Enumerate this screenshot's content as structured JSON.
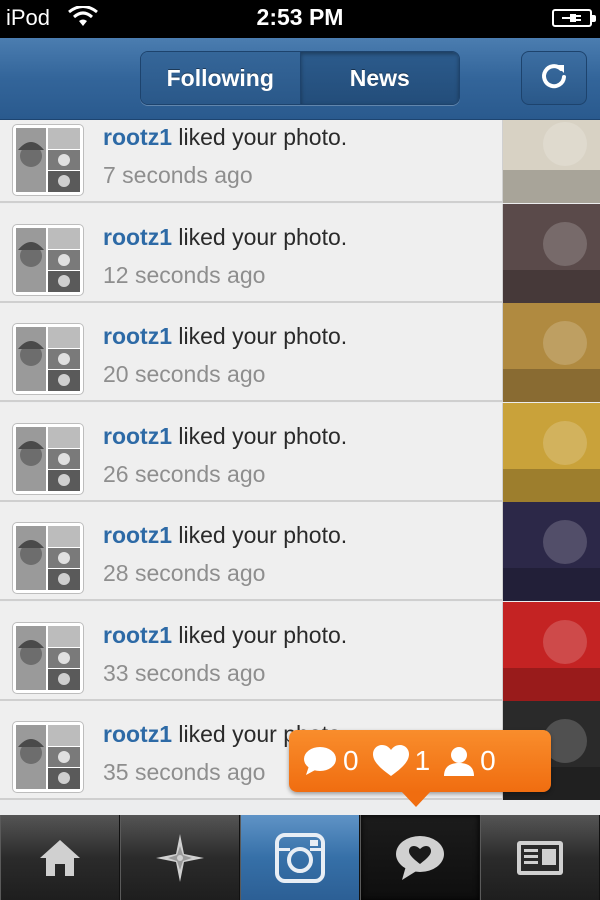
{
  "status_bar": {
    "carrier": "iPod",
    "time": "2:53 PM",
    "wifi_icon": "wifi-icon",
    "battery_icon": "battery-charging-icon"
  },
  "nav": {
    "tabs": [
      {
        "label": "Following",
        "selected": false
      },
      {
        "label": "News",
        "selected": true
      }
    ],
    "refresh_icon": "refresh-icon"
  },
  "feed": {
    "items": [
      {
        "username": "rootz1",
        "action": " liked your photo.",
        "time": "7 seconds ago",
        "thumb_color": "#d8d2c4"
      },
      {
        "username": "rootz1",
        "action": " liked your photo.",
        "time": "12 seconds ago",
        "thumb_color": "#5a4a4a"
      },
      {
        "username": "rootz1",
        "action": " liked your photo.",
        "time": "20 seconds ago",
        "thumb_color": "#b08a40"
      },
      {
        "username": "rootz1",
        "action": " liked your photo.",
        "time": "26 seconds ago",
        "thumb_color": "#c9a23a"
      },
      {
        "username": "rootz1",
        "action": " liked your photo.",
        "time": "28 seconds ago",
        "thumb_color": "#2c2848"
      },
      {
        "username": "rootz1",
        "action": " liked your photo.",
        "time": "33 seconds ago",
        "thumb_color": "#c42323"
      },
      {
        "username": "rootz1",
        "action": " liked your photo.",
        "time": "35 seconds ago",
        "thumb_color": "#2a2a2a"
      }
    ]
  },
  "badge": {
    "comments": "0",
    "likes": "1",
    "follows": "0",
    "color": "#f47a1f"
  },
  "tab_bar": {
    "items": [
      "home-icon",
      "explore-icon",
      "camera-icon",
      "news-icon",
      "profile-icon"
    ],
    "active": "news-icon",
    "camera_color": "#3a72aa"
  }
}
